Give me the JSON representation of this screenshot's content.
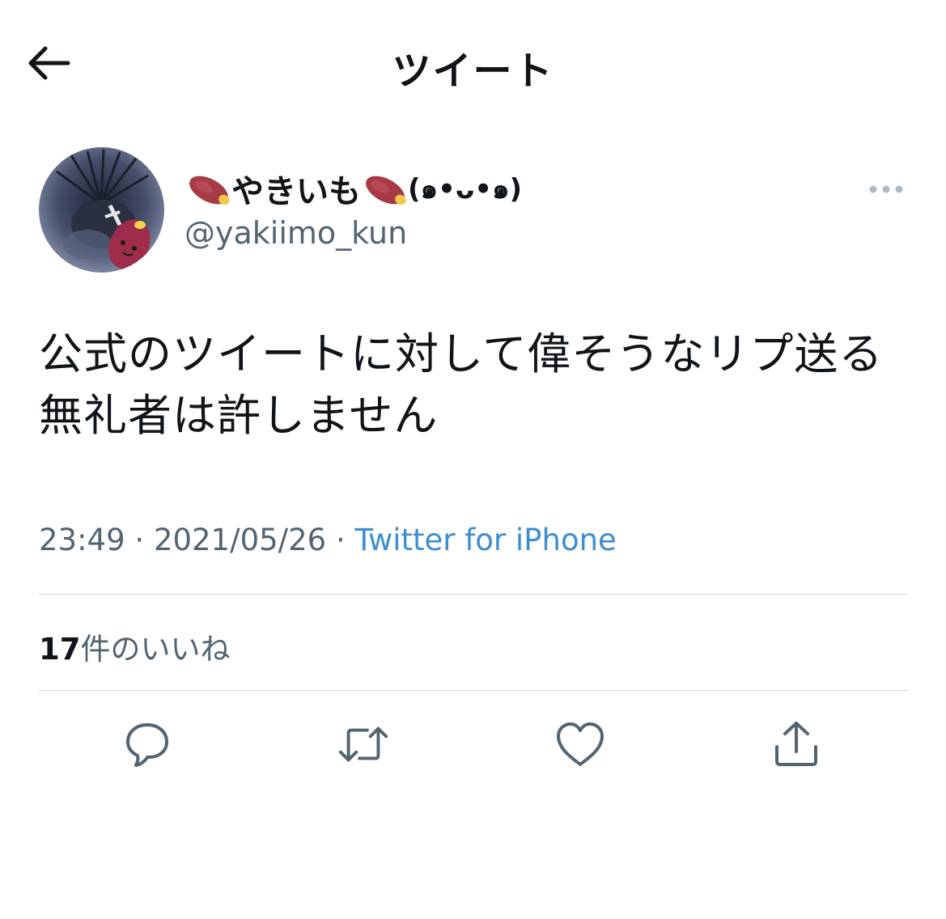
{
  "header": {
    "title": "ツイート",
    "back_icon": "arrow-left-icon"
  },
  "author": {
    "display_name_prefix": "やきいも",
    "display_name_suffix": "(๑•ᴗ•๑)",
    "name_emoji": "roasted-sweet-potato-icon",
    "handle": "@yakiimo_kun"
  },
  "tweet": {
    "text": "公式のツイートに対して偉そうなリプ送る無礼者は許しません",
    "time": "23:49",
    "separator": " · ",
    "date": "2021/05/26",
    "source": "Twitter for iPhone"
  },
  "stats": {
    "likes_count": "17",
    "likes_label": "件のいいね"
  },
  "actions": {
    "reply_icon": "reply-icon",
    "retweet_icon": "retweet-icon",
    "like_icon": "heart-icon",
    "share_icon": "share-icon"
  },
  "colors": {
    "text": "#0f1419",
    "secondary": "#536471",
    "link": "#3d8ed1",
    "divider": "#cfd9de",
    "icon": "#536471"
  }
}
